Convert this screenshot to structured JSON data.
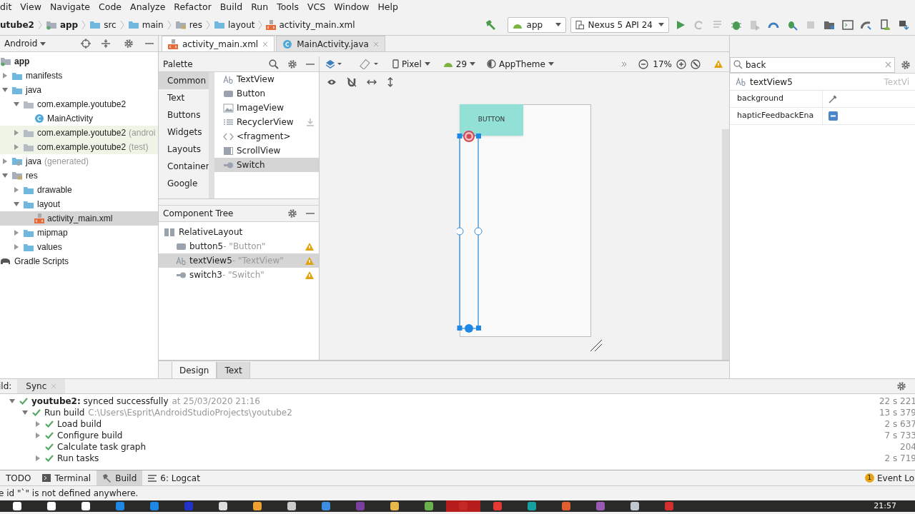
{
  "menu": [
    "dit",
    "View",
    "Navigate",
    "Code",
    "Analyze",
    "Refactor",
    "Build",
    "Run",
    "Tools",
    "VCS",
    "Window",
    "Help"
  ],
  "breadcrumbs": [
    {
      "label": "utube2",
      "kind": "project"
    },
    {
      "label": "app",
      "kind": "module"
    },
    {
      "label": "src",
      "kind": "folder"
    },
    {
      "label": "main",
      "kind": "folder"
    },
    {
      "label": "res",
      "kind": "res"
    },
    {
      "label": "layout",
      "kind": "folder"
    },
    {
      "label": "activity_main.xml",
      "kind": "xml"
    }
  ],
  "run_config": "app",
  "device": "Nexus 5 API 24",
  "project": {
    "view": "Android",
    "tree": [
      {
        "label": "app",
        "kind": "module",
        "selected": false,
        "children": [
          {
            "label": "manifests",
            "kind": "folder",
            "expanded": false,
            "selected": false
          },
          {
            "label": "java",
            "kind": "folder",
            "expanded": true,
            "selected": false,
            "children": [
              {
                "label": "com.example.youtube2",
                "kind": "package",
                "expanded": true,
                "selected": false,
                "children": [
                  {
                    "label": "MainActivity",
                    "kind": "class",
                    "selected": false
                  }
                ]
              },
              {
                "label": "com.example.youtube2",
                "suffix": "(androi",
                "kind": "package",
                "expanded": false,
                "selected": false,
                "test_source": true
              },
              {
                "label": "com.example.youtube2",
                "suffix": "(test)",
                "kind": "package",
                "expanded": false,
                "selected": false,
                "test_source": true
              }
            ]
          },
          {
            "label": "java",
            "suffix": "(generated)",
            "kind": "generated",
            "expanded": false,
            "selected": false
          },
          {
            "label": "res",
            "kind": "res",
            "expanded": true,
            "selected": false,
            "children": [
              {
                "label": "drawable",
                "kind": "folder",
                "expanded": false,
                "selected": false
              },
              {
                "label": "layout",
                "kind": "folder",
                "expanded": true,
                "selected": false,
                "children": [
                  {
                    "label": "activity_main.xml",
                    "kind": "xml",
                    "selected": true
                  }
                ]
              },
              {
                "label": "mipmap",
                "kind": "folder",
                "expanded": false,
                "selected": false
              },
              {
                "label": "values",
                "kind": "folder",
                "expanded": false,
                "selected": false
              }
            ]
          }
        ]
      },
      {
        "label": "Gradle Scripts",
        "kind": "gradle",
        "selected": false
      }
    ]
  },
  "editor_tabs": [
    {
      "label": "activity_main.xml",
      "kind": "xml",
      "selected": true
    },
    {
      "label": "MainActivity.java",
      "kind": "class",
      "selected": false
    }
  ],
  "palette": {
    "title": "Palette",
    "categories": [
      {
        "label": "Common",
        "selected": true
      },
      {
        "label": "Text",
        "selected": false
      },
      {
        "label": "Buttons",
        "selected": false
      },
      {
        "label": "Widgets",
        "selected": false
      },
      {
        "label": "Layouts",
        "selected": false
      },
      {
        "label": "Container",
        "selected": false
      },
      {
        "label": "Google",
        "selected": false
      }
    ],
    "items": [
      {
        "label": "TextView",
        "kind": "text",
        "selected": false
      },
      {
        "label": "Button",
        "kind": "button",
        "selected": false
      },
      {
        "label": "ImageView",
        "kind": "image",
        "selected": false
      },
      {
        "label": "RecyclerView",
        "kind": "list",
        "selected": false,
        "download": true
      },
      {
        "label": "<fragment>",
        "kind": "code",
        "selected": false
      },
      {
        "label": "ScrollView",
        "kind": "scroll",
        "selected": false
      },
      {
        "label": "Switch",
        "kind": "switch",
        "selected": true
      }
    ]
  },
  "design_toolbar": {
    "device": "Pixel",
    "api": "29",
    "theme": "AppTheme",
    "zoom": "17%"
  },
  "component_tree": {
    "title": "Component Tree",
    "root": "RelativeLayout",
    "children": [
      {
        "id": "button5",
        "text": "- \"Button\"",
        "kind": "button",
        "warning": true,
        "selected": false
      },
      {
        "id": "textView5",
        "text": "- \"TextView\"",
        "kind": "text",
        "warning": true,
        "selected": true
      },
      {
        "id": "switch3",
        "text": "- \"Switch\"",
        "kind": "switch",
        "warning": true,
        "selected": false
      }
    ]
  },
  "canvas": {
    "button_text": "BUTTON"
  },
  "attributes": {
    "search": "back",
    "component": "textView5",
    "component_type": "TextVi",
    "rows": [
      {
        "name": "background",
        "kind": "picker"
      },
      {
        "name": "hapticFeedbackEna",
        "kind": "flag"
      }
    ]
  },
  "design_tabs": [
    {
      "label": "Design",
      "selected": true
    },
    {
      "label": "Text",
      "selected": false
    }
  ],
  "build": {
    "label": "ild:",
    "tab": "Sync",
    "rows": [
      {
        "text": "**youtube2:** synced successfully",
        "detail": "at 25/03/2020 21:16",
        "time": "22 s 221",
        "expanded": true,
        "children": [
          {
            "text": "Run build",
            "detail": "C:\\Users\\Esprit\\AndroidStudioProjects\\youtube2",
            "time": "13 s 379",
            "expanded": true,
            "children": [
              {
                "text": "Load build",
                "time": "2 s 637",
                "expanded": false
              },
              {
                "text": "Configure build",
                "time": "7 s 733",
                "expanded": false
              },
              {
                "text": "Calculate task graph",
                "time": "204"
              },
              {
                "text": "Run tasks",
                "time": "2 s 719",
                "expanded": false
              }
            ]
          }
        ]
      }
    ]
  },
  "tool_tabs": [
    {
      "label": "TODO",
      "kind": "none",
      "selected": false
    },
    {
      "label": "Terminal",
      "kind": "terminal",
      "selected": false
    },
    {
      "label": "Build",
      "kind": "hammer",
      "selected": true
    },
    {
      "label": "6: Logcat",
      "kind": "lines",
      "selected": false
    }
  ],
  "event_log": {
    "count": "1",
    "label": "Event Lo"
  },
  "status": "e id \"`\" is not defined anywhere.",
  "clock": "21:57"
}
